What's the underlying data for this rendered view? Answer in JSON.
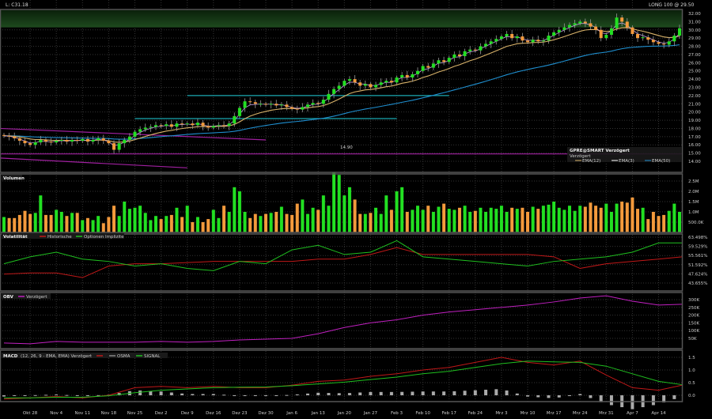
{
  "header": {
    "symbol_label": "L: C31.18",
    "position_label": "LONG 100 @ 29.50"
  },
  "price_legend": {
    "title": "GPRE@SMART Verzögert",
    "subtitle": "Verzögert",
    "ema12": "EMA(12)",
    "ema3": "EMA(3)",
    "ema50": "EMA(50)"
  },
  "price_line_label": "14.90",
  "panes": {
    "volume": {
      "title": "Volumen"
    },
    "volatility": {
      "title": "Volatilität",
      "hist": "Historische",
      "impl": "Optionen Implizite"
    },
    "obv": {
      "title": "OBV",
      "series": "Verzögert"
    },
    "macd": {
      "title": "MACD",
      "params": "(12, 26, 9 - EMA, EMA) Verzögert",
      "osma": "OSMA",
      "signal": "SIGNAL"
    }
  },
  "colors": {
    "up": "#22e022",
    "down": "#f39a3c",
    "ema12": "#d9b36a",
    "ema3": "#c9a2ea",
    "ema50": "#1f8fd0",
    "hist": "#c01818",
    "impl": "#1fbf1f",
    "obv": "#c020c0",
    "macd": "#c01818",
    "signal": "#1fbf1f",
    "cyan": "#1aa7b0",
    "purple": "#a020a0"
  },
  "chart_data": [
    {
      "type": "candlestick",
      "pane": "price",
      "x_labels": [
        "Okt 28",
        "Nov 4",
        "Nov 11",
        "Nov 18",
        "Nov 25",
        "Dez 2",
        "Dez 9",
        "Dez 16",
        "Dez 23",
        "Dez 30",
        "Jan 6",
        "Jan 13",
        "Jan 20",
        "Jan 27",
        "Feb 3",
        "Feb 10",
        "Feb 17",
        "Feb 24",
        "Mrz 3",
        "Mrz 10",
        "Mrz 17",
        "Mrz 24",
        "Mrz 31",
        "Apr 7",
        "Apr 14"
      ],
      "y_ticks": [
        "32.00",
        "31.00",
        "30.00",
        "29.00",
        "28.00",
        "27.00",
        "26.00",
        "25.00",
        "24.00",
        "23.00",
        "22.00",
        "21.00",
        "20.00",
        "19.00",
        "18.00",
        "17.00",
        "16.00",
        "15.00",
        "14.00"
      ],
      "ylim": [
        14,
        32
      ],
      "close": [
        17.1,
        17.0,
        16.8,
        16.5,
        16.2,
        16.0,
        16.3,
        16.6,
        16.4,
        16.3,
        16.5,
        16.6,
        16.4,
        16.6,
        16.5,
        16.7,
        16.4,
        16.6,
        16.8,
        16.5,
        16.2,
        15.4,
        16.2,
        16.6,
        17.0,
        17.6,
        17.9,
        18.1,
        18.2,
        18.4,
        18.3,
        18.5,
        18.2,
        18.6,
        18.5,
        18.6,
        18.4,
        18.7,
        18.3,
        18.1,
        18.3,
        18.4,
        18.3,
        18.6,
        19.5,
        20.5,
        21.3,
        21.2,
        21.0,
        21.0,
        20.9,
        21.0,
        20.8,
        20.9,
        20.6,
        20.4,
        20.3,
        20.6,
        20.9,
        21.1,
        21.0,
        21.5,
        22.2,
        22.8,
        23.2,
        23.8,
        24.0,
        23.6,
        23.2,
        23.4,
        23.0,
        23.3,
        23.6,
        23.8,
        23.6,
        24.2,
        24.5,
        24.2,
        24.6,
        25.0,
        25.6,
        25.4,
        25.9,
        26.3,
        26.1,
        26.6,
        27.0,
        26.8,
        27.4,
        27.6,
        27.5,
        28.0,
        28.3,
        28.6,
        28.9,
        29.2,
        29.5,
        29.0,
        29.2,
        28.7,
        28.5,
        28.8,
        28.6,
        28.7,
        29.3,
        29.7,
        30.0,
        30.3,
        30.6,
        30.8,
        31.0,
        30.8,
        30.4,
        30.0,
        29.0,
        29.4,
        30.2,
        31.5,
        31.0,
        30.3,
        29.5,
        29.0,
        29.1,
        28.8,
        28.5,
        28.3,
        28.2,
        28.6,
        29.3,
        30.2
      ],
      "indicators": [
        "EMA(12)",
        "EMA(3)",
        "EMA(50)"
      ],
      "horizontal_line": 14.9,
      "zone": [
        30.3,
        32.4
      ],
      "trendlines": [
        {
          "color": "cyan",
          "from": "Dez 9",
          "to": "Feb 17",
          "price_from": 22.0,
          "price_to": 22.0
        },
        {
          "color": "cyan",
          "from": "Nov 25",
          "to": "Feb 3",
          "price_from": 19.2,
          "price_to": 19.2
        },
        {
          "color": "purple",
          "from": null,
          "to": "Dez 30",
          "price_from": 18.0,
          "price_to": 16.6
        },
        {
          "color": "purple",
          "from": null,
          "to": "Dez 9",
          "price_from": 14.4,
          "price_to": 13.2
        }
      ]
    },
    {
      "type": "bar",
      "pane": "volume",
      "unit": "M",
      "y_ticks": [
        "2.5M",
        "2.0M",
        "1.5M",
        "1.0M",
        "500.0K"
      ],
      "ylim": [
        0,
        3
      ],
      "values": [
        0.75,
        0.7,
        0.7,
        0.85,
        1.05,
        0.9,
        0.95,
        1.8,
        0.85,
        0.85,
        1.1,
        1.0,
        0.8,
        0.95,
        0.95,
        0.6,
        0.7,
        0.6,
        0.8,
        0.45,
        0.75,
        1.3,
        0.8,
        1.5,
        1.15,
        1.2,
        1.3,
        0.95,
        0.6,
        0.8,
        0.65,
        0.8,
        0.85,
        1.2,
        0.75,
        1.3,
        0.5,
        0.75,
        0.5,
        0.65,
        1.1,
        0.7,
        1.3,
        1.0,
        2.2,
        2.0,
        1.0,
        0.7,
        0.9,
        0.8,
        0.9,
        0.95,
        1.0,
        1.25,
        0.9,
        0.85,
        1.4,
        1.6,
        0.9,
        1.2,
        1.1,
        1.8,
        1.3,
        2.9,
        2.8,
        1.8,
        2.2,
        1.6,
        0.9,
        0.9,
        0.95,
        1.2,
        0.9,
        1.8,
        1.1,
        2.0,
        2.2,
        1.0,
        1.1,
        1.3,
        1.1,
        1.3,
        1.0,
        1.25,
        1.4,
        1.15,
        1.1,
        1.2,
        1.3,
        1.0,
        1.05,
        1.2,
        1.0,
        1.2,
        1.15,
        1.3,
        1.0,
        1.2,
        1.15,
        1.2,
        1.0,
        1.25,
        1.15,
        1.3,
        1.35,
        1.5,
        1.2,
        1.1,
        1.3,
        1.05,
        1.3,
        1.25,
        1.45,
        1.3,
        1.2,
        1.4,
        1.0,
        1.4,
        1.5,
        1.45,
        1.7,
        1.15,
        1.2,
        0.65,
        1.0,
        0.8,
        0.85,
        1.05,
        1.4,
        1.0
      ]
    },
    {
      "type": "line",
      "pane": "volatility",
      "unit": "%",
      "sampling": "weekly",
      "y_ticks": [
        "63.498%",
        "59.529%",
        "55.561%",
        "51.592%",
        "47.624%",
        "43.655%"
      ],
      "ylim": [
        43.655,
        63.498
      ],
      "series": [
        {
          "name": "Historische",
          "values": [
            47.5,
            48,
            48,
            46,
            51,
            52,
            52,
            52.5,
            53,
            53,
            53,
            53,
            54,
            54,
            56,
            59,
            56,
            56,
            56,
            56,
            56,
            55,
            50,
            52,
            53,
            54,
            55
          ]
        },
        {
          "name": "Optionen Implizite",
          "values": [
            52,
            55,
            57,
            54,
            53,
            51,
            52,
            50,
            49,
            53,
            52,
            58,
            60,
            56,
            57,
            62,
            55,
            54,
            53,
            52,
            51,
            53,
            54,
            55,
            57,
            61,
            61
          ]
        }
      ]
    },
    {
      "type": "line",
      "pane": "obv",
      "unit": "K",
      "sampling": "weekly",
      "y_ticks": [
        "300K",
        "250K",
        "200K",
        "150K",
        "100K",
        "50K"
      ],
      "ylim": [
        0,
        330
      ],
      "series": [
        {
          "name": "Verzögert",
          "values": [
            20,
            15,
            30,
            25,
            25,
            25,
            30,
            25,
            30,
            40,
            45,
            50,
            80,
            120,
            150,
            170,
            200,
            220,
            235,
            250,
            265,
            285,
            310,
            325,
            290,
            265,
            270
          ]
        }
      ]
    },
    {
      "type": "line",
      "pane": "macd",
      "sampling": "weekly",
      "y_ticks": [
        "1.5",
        "1.0",
        "0.5",
        "0.0"
      ],
      "ylim": [
        -0.6,
        1.7
      ],
      "series": [
        {
          "name": "MACD",
          "values": [
            -0.15,
            -0.1,
            -0.05,
            -0.1,
            0.0,
            0.3,
            0.35,
            0.3,
            0.35,
            0.3,
            0.3,
            0.4,
            0.55,
            0.6,
            0.75,
            0.85,
            1.0,
            1.1,
            1.3,
            1.5,
            1.3,
            1.2,
            1.35,
            0.8,
            0.3,
            0.2,
            0.4
          ]
        },
        {
          "name": "SIGNAL",
          "values": [
            -0.1,
            -0.1,
            -0.08,
            -0.08,
            -0.02,
            0.1,
            0.2,
            0.25,
            0.3,
            0.32,
            0.33,
            0.38,
            0.45,
            0.52,
            0.62,
            0.72,
            0.85,
            0.95,
            1.1,
            1.25,
            1.35,
            1.32,
            1.3,
            1.15,
            0.85,
            0.55,
            0.42
          ]
        }
      ]
    }
  ]
}
